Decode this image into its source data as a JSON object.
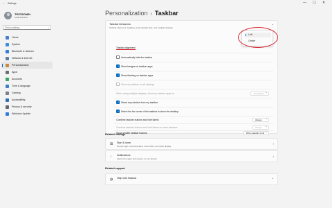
{
  "window": {
    "app_name": "Settings",
    "back": "←",
    "minimize": "—",
    "maximize": "▢",
    "close": "✕"
  },
  "user": {
    "name": "TESTADMIN",
    "account": "Local Account"
  },
  "search": {
    "placeholder": "Find a setting",
    "icon": "search-icon"
  },
  "nav": [
    {
      "label": "Home",
      "color": "#4a7bd0"
    },
    {
      "label": "System",
      "color": "#3a8ee6"
    },
    {
      "label": "Bluetooth & devices",
      "color": "#2f7fd8"
    },
    {
      "label": "Network & internet",
      "color": "#5a7fa8"
    },
    {
      "label": "Personalization",
      "color": "#c98a3a"
    },
    {
      "label": "Apps",
      "color": "#6a6f78"
    },
    {
      "label": "Accounts",
      "color": "#3aa36a"
    },
    {
      "label": "Time & language",
      "color": "#3a7fc8"
    },
    {
      "label": "Gaming",
      "color": "#7a7f88"
    },
    {
      "label": "Accessibility",
      "color": "#2f6fb8"
    },
    {
      "label": "Privacy & security",
      "color": "#5f6670"
    },
    {
      "label": "Windows Update",
      "color": "#2f7fd8"
    }
  ],
  "breadcrumb": {
    "parent": "Personalization",
    "separator": "›",
    "current": "Taskbar"
  },
  "behaviors": {
    "title": "Taskbar behaviors",
    "subtitle": "Taskbar alignment, badging, automatically hide, and multiple displays",
    "alignment_label": "Taskbar alignment",
    "alignment_options": [
      "Left",
      "Center"
    ],
    "alignment_selected": "Left",
    "rows": [
      {
        "label": "Automatically hide the taskbar",
        "checked": false,
        "dim": false
      },
      {
        "label": "Show badges on taskbar apps",
        "checked": true,
        "dim": false
      },
      {
        "label": "Show flashing on taskbar apps",
        "checked": true,
        "dim": false
      },
      {
        "label": "Show my taskbar on all displays",
        "checked": false,
        "dim": true
      },
      {
        "label": "When using multiple displays, show my taskbar apps on",
        "select": "All taskbars",
        "dim": true
      },
      {
        "label": "Share any window from my taskbar",
        "checked": true,
        "dim": false
      },
      {
        "label": "Select the far corner of the taskbar to show the desktop",
        "checked": true,
        "dim": false
      },
      {
        "label": "Combine taskbar buttons and hide labels",
        "select": "Always",
        "dim": false
      },
      {
        "label": "Combine taskbar buttons and hide labels on other taskbars",
        "select": "Always",
        "dim": true
      },
      {
        "label": "Show smaller taskbar buttons",
        "select": "When taskbar is full",
        "dim": false
      }
    ]
  },
  "related_settings": {
    "title": "Related settings",
    "cards": [
      {
        "title": "Start & more",
        "subtitle": "Pinned apps, recommended, recent files, and other display",
        "icon": "start-icon"
      },
      {
        "title": "Notifications",
        "subtitle": "Alerts from apps and system, do not disturb",
        "icon": "bell-icon"
      }
    ]
  },
  "related_support": {
    "title": "Related support",
    "cards": [
      {
        "title": "Help with Taskbar",
        "icon": "globe-icon"
      }
    ]
  },
  "colors": {
    "accent": "#0067c0",
    "annotation": "#d9232d"
  }
}
